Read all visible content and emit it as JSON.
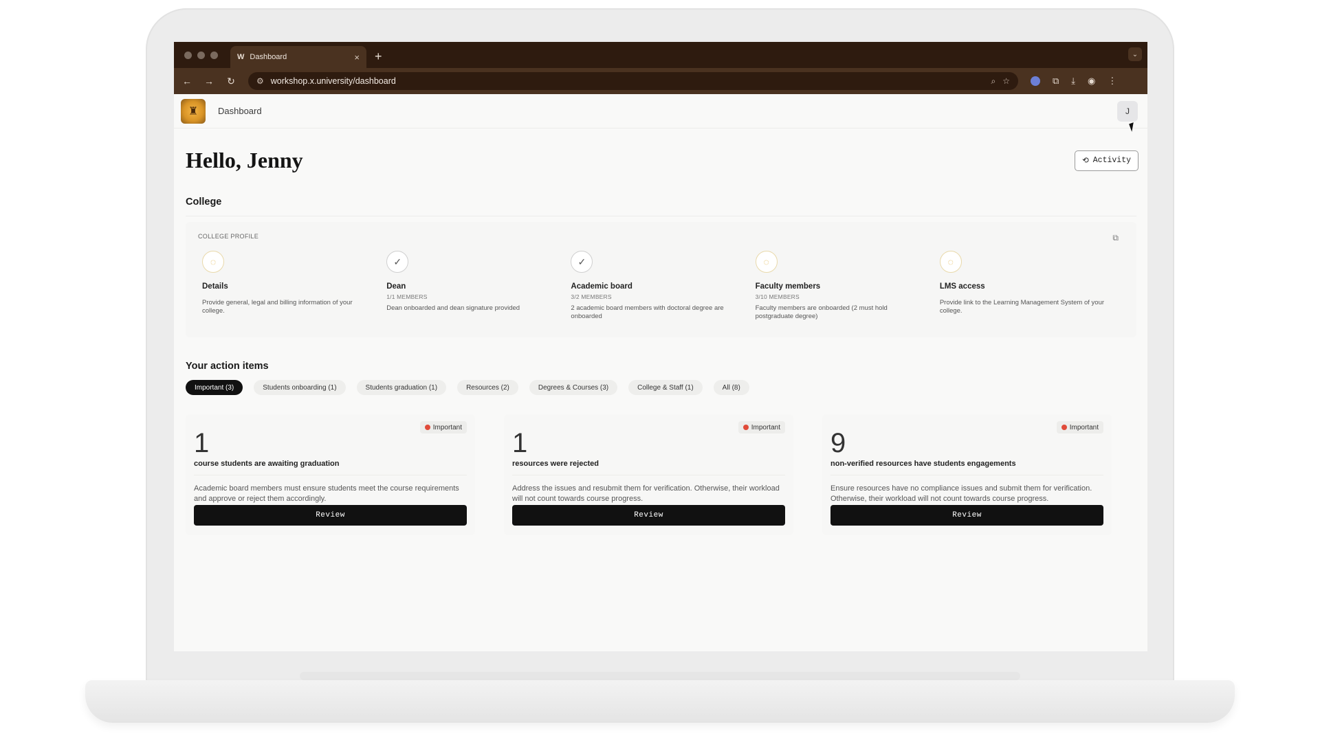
{
  "browser": {
    "tab_favicon": "W",
    "tab_title": "Dashboard",
    "tab_close": "×",
    "new_tab": "+",
    "url": "workshop.x.university/dashboard"
  },
  "appbar": {
    "title": "Dashboard",
    "avatar_initial": "J"
  },
  "greeting": "Hello, Jenny",
  "activity_label": "Activity",
  "college": {
    "title": "College",
    "profile_label": "COLLEGE PROFILE",
    "steps": [
      {
        "name": "Details",
        "meta": "",
        "desc": "Provide general, legal and billing information of your college.",
        "status": "pending"
      },
      {
        "name": "Dean",
        "meta": "1/1 MEMBERS",
        "desc": "Dean onboarded and dean signature provided",
        "status": "done"
      },
      {
        "name": "Academic board",
        "meta": "3/2 MEMBERS",
        "desc": "2 academic board members with doctoral degree are onboarded",
        "status": "done"
      },
      {
        "name": "Faculty members",
        "meta": "3/10 MEMBERS",
        "desc": "Faculty members are onboarded (2 must hold postgraduate degree)",
        "status": "pending"
      },
      {
        "name": "LMS access",
        "meta": "",
        "desc": "Provide link to the Learning Management System of your college.",
        "status": "pending"
      }
    ]
  },
  "actions": {
    "title": "Your action items",
    "chips": [
      "Important (3)",
      "Students onboarding (1)",
      "Students graduation (1)",
      "Resources (2)",
      "Degrees & Courses (3)",
      "College & Staff (1)",
      "All (8)"
    ],
    "cards": [
      {
        "badge": "Important",
        "count": "1",
        "headline": "course students are awaiting graduation",
        "desc": "Academic board members must ensure students meet the course requirements and approve or reject them accordingly.",
        "button": "Review"
      },
      {
        "badge": "Important",
        "count": "1",
        "headline": "resources were rejected",
        "desc": "Address the issues and resubmit them for verification. Otherwise, their workload will not count towards course progress.",
        "button": "Review"
      },
      {
        "badge": "Important",
        "count": "9",
        "headline": "non-verified resources have students engagements",
        "desc": "Ensure resources have no compliance issues and submit them for verification. Otherwise, their workload will not count towards course progress.",
        "button": "Review"
      }
    ]
  }
}
